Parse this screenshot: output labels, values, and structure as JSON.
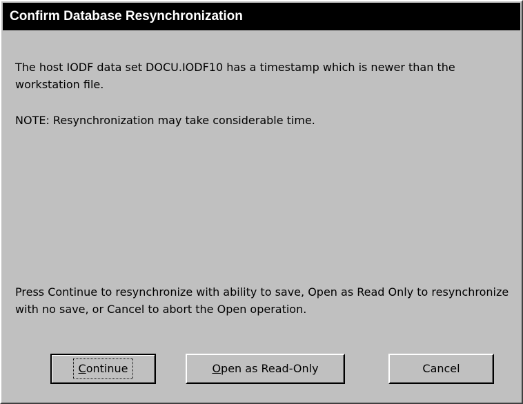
{
  "dialog": {
    "title": "Confirm Database Resynchronization",
    "message_1": "The host IODF data set DOCU.IODF10 has a timestamp which is newer than the workstation file.",
    "message_2": "NOTE: Resynchronization may take considerable time.",
    "message_3": "Press Continue to resynchronize with ability to save, Open as Read Only to resynchronize with no save, or Cancel to abort the Open operation."
  },
  "buttons": {
    "continue": {
      "mnemonic": "C",
      "rest": "ontinue"
    },
    "open_read_only": {
      "mnemonic": "O",
      "rest": "pen as Read-Only"
    },
    "cancel": {
      "label": "Cancel"
    }
  },
  "colors": {
    "dialog_bg": "#c0c0c0",
    "titlebar_bg": "#000000",
    "titlebar_text": "#ffffff"
  }
}
